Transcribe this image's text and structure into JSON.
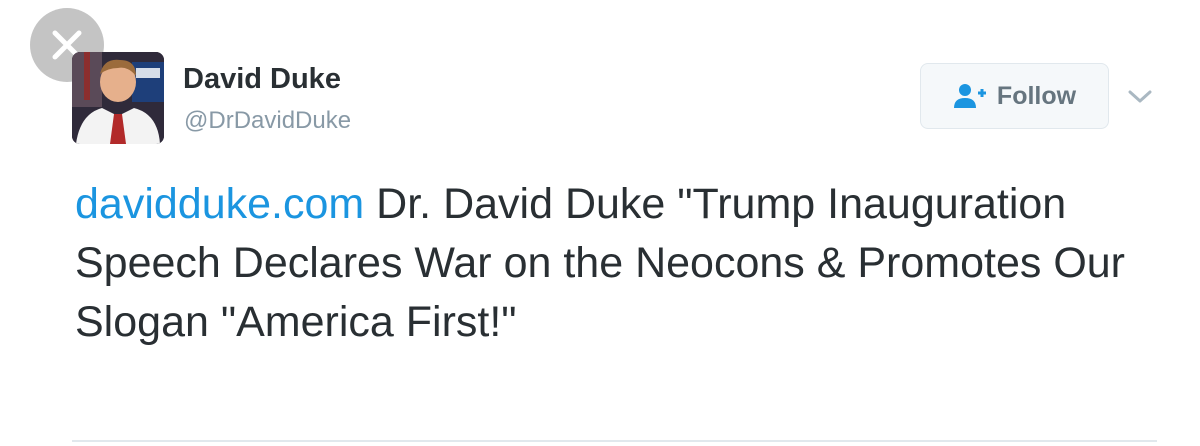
{
  "overlay": {
    "close_icon": "close-icon"
  },
  "tweet": {
    "author": {
      "display_name": "David Duke",
      "handle": "@DrDavidDuke",
      "avatar_icon": "profile-photo"
    },
    "follow_button": {
      "label": "Follow",
      "icon": "follow-user-icon"
    },
    "menu_icon": "chevron-down-icon",
    "link_text": "davidduke.com",
    "body_text": " Dr. David Duke \"Trump Inauguration Speech Declares War on the Neocons & Promotes Our Slogan \"America First!\""
  },
  "colors": {
    "link": "#1b95e0",
    "text": "#292f33",
    "secondary": "#8899a6",
    "button_bg": "#f5f8fa",
    "button_text": "#66757f",
    "close_bg": "#c4c4c4"
  }
}
